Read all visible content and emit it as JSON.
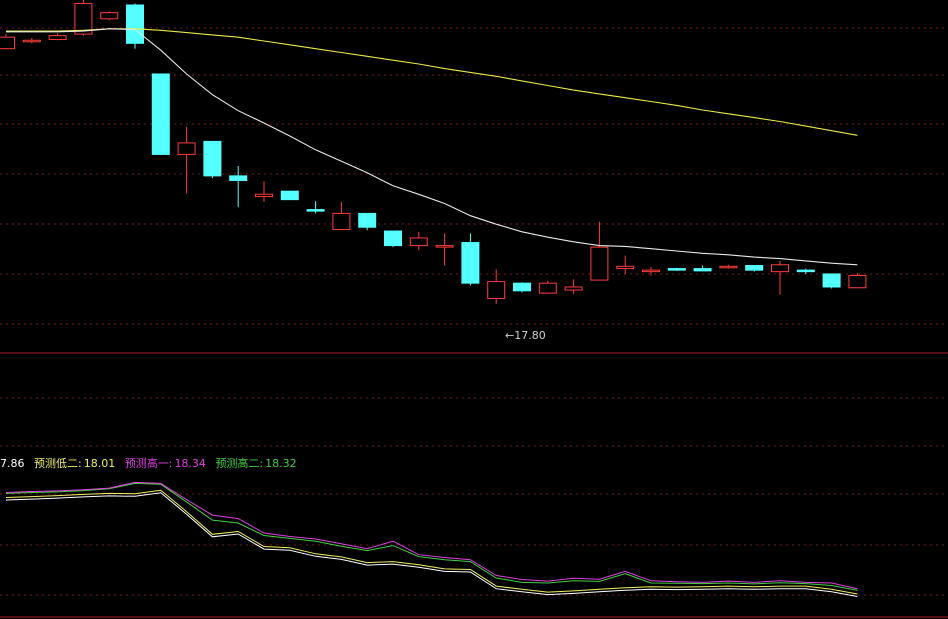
{
  "colors": {
    "background": "#000000",
    "grid": "#7a1a1a",
    "panel_border": "#b01e1e",
    "up_candle": "#ff3c3c",
    "down_candle": "#54ffff",
    "ma_short": "#e8e8e8",
    "ma_long": "#e8e84a",
    "low1": "#ffffff",
    "low2": "#f0f060",
    "high1": "#e040e0",
    "high2": "#40d040"
  },
  "legend": {
    "low1": "7.86",
    "low2_label": "预测低二:",
    "low2_value": "18.01",
    "high1_label": "预测高一:",
    "high1_value": "18.34",
    "high2_label": "预测高二:",
    "high2_value": "18.32"
  },
  "annotation": {
    "text": "←17.80"
  },
  "chart_data": [
    {
      "type": "candlestick",
      "panel": "price",
      "grid": true,
      "ylim": [
        17.55,
        21.7
      ],
      "candles": [
        {
          "o": 21.13,
          "c": 21.28,
          "h": 21.32,
          "l": 21.12
        },
        {
          "o": 21.24,
          "c": 21.24,
          "h": 21.27,
          "l": 21.2
        },
        {
          "o": 21.25,
          "c": 21.3,
          "h": 21.33,
          "l": 21.24
        },
        {
          "o": 21.32,
          "c": 21.72,
          "h": 21.8,
          "l": 21.3
        },
        {
          "o": 21.52,
          "c": 21.6,
          "h": 21.62,
          "l": 21.5
        },
        {
          "o": 21.7,
          "c": 21.2,
          "h": 21.72,
          "l": 21.13
        },
        {
          "o": 20.8,
          "c": 19.75,
          "h": 20.8,
          "l": 19.74
        },
        {
          "o": 19.75,
          "c": 19.9,
          "h": 20.11,
          "l": 19.24
        },
        {
          "o": 19.92,
          "c": 19.47,
          "h": 19.92,
          "l": 19.44
        },
        {
          "o": 19.47,
          "c": 19.41,
          "h": 19.6,
          "l": 19.06
        },
        {
          "o": 19.2,
          "c": 19.23,
          "h": 19.4,
          "l": 19.13
        },
        {
          "o": 19.27,
          "c": 19.16,
          "h": 19.27,
          "l": 19.16
        },
        {
          "o": 19.03,
          "c": 19.01,
          "h": 19.14,
          "l": 18.98
        },
        {
          "o": 18.77,
          "c": 18.98,
          "h": 19.13,
          "l": 18.77
        },
        {
          "o": 18.98,
          "c": 18.8,
          "h": 18.98,
          "l": 18.76
        },
        {
          "o": 18.75,
          "c": 18.56,
          "h": 18.75,
          "l": 18.54
        },
        {
          "o": 18.56,
          "c": 18.66,
          "h": 18.74,
          "l": 18.5
        },
        {
          "o": 18.55,
          "c": 18.56,
          "h": 18.72,
          "l": 18.3
        },
        {
          "o": 18.6,
          "c": 18.07,
          "h": 18.72,
          "l": 18.04
        },
        {
          "o": 17.87,
          "c": 18.09,
          "h": 18.25,
          "l": 17.8
        },
        {
          "o": 18.07,
          "c": 17.97,
          "h": 18.08,
          "l": 17.95
        },
        {
          "o": 17.94,
          "c": 18.07,
          "h": 18.1,
          "l": 17.94
        },
        {
          "o": 17.98,
          "c": 18.02,
          "h": 18.12,
          "l": 17.93
        },
        {
          "o": 18.11,
          "c": 18.54,
          "h": 18.87,
          "l": 18.11
        },
        {
          "o": 18.26,
          "c": 18.29,
          "h": 18.43,
          "l": 18.19
        },
        {
          "o": 18.24,
          "c": 18.24,
          "h": 18.28,
          "l": 18.17
        },
        {
          "o": 18.26,
          "c": 18.24,
          "h": 18.27,
          "l": 18.23
        },
        {
          "o": 18.26,
          "c": 18.23,
          "h": 18.3,
          "l": 18.23
        },
        {
          "o": 18.28,
          "c": 18.29,
          "h": 18.31,
          "l": 18.26
        },
        {
          "o": 18.3,
          "c": 18.24,
          "h": 18.3,
          "l": 18.22
        },
        {
          "o": 18.22,
          "c": 18.31,
          "h": 18.36,
          "l": 17.92
        },
        {
          "o": 18.24,
          "c": 18.22,
          "h": 18.26,
          "l": 18.19
        },
        {
          "o": 18.19,
          "c": 18.02,
          "h": 18.19,
          "l": 18.0
        },
        {
          "o": 18.01,
          "c": 18.17,
          "h": 18.2,
          "l": 18.01
        }
      ],
      "ma_short": [
        21.35,
        21.35,
        21.35,
        21.36,
        21.39,
        21.38,
        21.11,
        20.8,
        20.53,
        20.32,
        20.16,
        19.99,
        19.81,
        19.66,
        19.51,
        19.34,
        19.23,
        19.11,
        18.95,
        18.84,
        18.74,
        18.67,
        18.61,
        18.56,
        18.55,
        18.52,
        18.49,
        18.46,
        18.44,
        18.41,
        18.39,
        18.36,
        18.33,
        18.31
      ],
      "ma_long": [
        21.36,
        21.36,
        21.36,
        21.37,
        21.39,
        21.39,
        21.37,
        21.34,
        21.31,
        21.28,
        21.23,
        21.18,
        21.13,
        21.08,
        21.03,
        20.98,
        20.93,
        20.87,
        20.82,
        20.77,
        20.71,
        20.65,
        20.59,
        20.54,
        20.49,
        20.44,
        20.39,
        20.33,
        20.28,
        20.23,
        20.18,
        20.12,
        20.06,
        20.0
      ]
    },
    {
      "type": "line",
      "panel": "forecast",
      "grid": true,
      "ylim": [
        17.6,
        21.8
      ],
      "series": [
        {
          "name": "预测低二",
          "values": [
            21.02,
            21.05,
            21.08,
            21.12,
            21.15,
            21.14,
            21.25,
            20.57,
            19.85,
            19.94,
            19.46,
            19.42,
            19.23,
            19.13,
            18.95,
            18.98,
            18.88,
            18.75,
            18.73,
            18.2,
            18.1,
            18.01,
            18.05,
            18.1,
            18.15,
            18.18,
            18.17,
            18.18,
            18.2,
            18.18,
            18.2,
            18.2,
            18.1,
            17.95
          ]
        },
        {
          "name": "预测高一",
          "values": [
            21.18,
            21.21,
            21.23,
            21.27,
            21.32,
            21.5,
            21.47,
            20.95,
            20.46,
            20.35,
            19.89,
            19.78,
            19.7,
            19.55,
            19.39,
            19.63,
            19.2,
            19.11,
            19.04,
            18.54,
            18.41,
            18.36,
            18.45,
            18.42,
            18.67,
            18.37,
            18.34,
            18.32,
            18.36,
            18.32,
            18.37,
            18.32,
            18.3,
            18.12
          ]
        },
        {
          "name": "预测高二",
          "values": [
            21.15,
            21.18,
            21.2,
            21.24,
            21.3,
            21.47,
            21.44,
            20.88,
            20.3,
            20.21,
            19.81,
            19.72,
            19.63,
            19.47,
            19.33,
            19.49,
            19.14,
            19.04,
            18.98,
            18.46,
            18.32,
            18.3,
            18.37,
            18.35,
            18.6,
            18.3,
            18.29,
            18.28,
            18.3,
            18.27,
            18.31,
            18.28,
            18.22,
            18.07
          ]
        }
      ]
    }
  ]
}
